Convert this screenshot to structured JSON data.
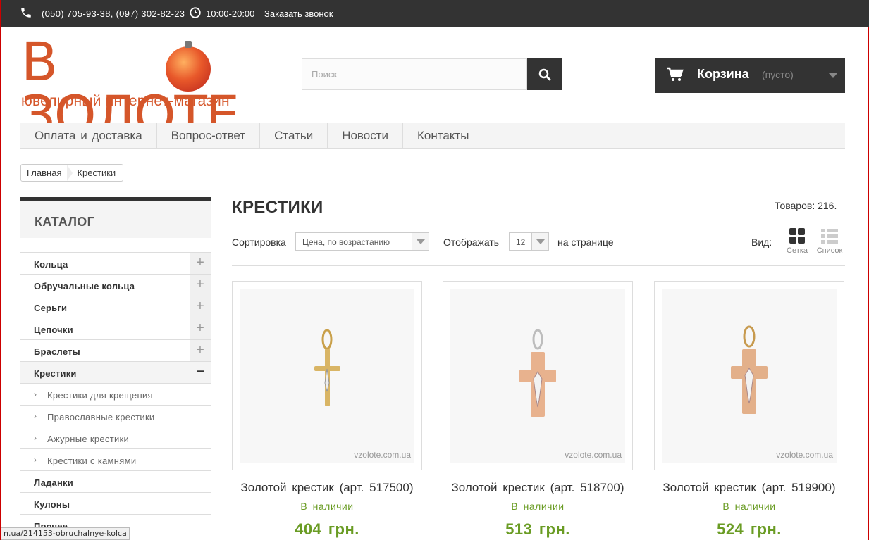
{
  "topbar": {
    "phones": "(050) 705-93-38, (097) 302-82-23",
    "hours": "10:00-20:00",
    "callback": "Заказать звонок"
  },
  "logo": {
    "brand": "В ЗОЛОТЕ",
    "tagline": "ювелирный интернет-магазин"
  },
  "search": {
    "placeholder": "Поиск"
  },
  "cart": {
    "label": "Корзина",
    "status": "(пусто)"
  },
  "nav": [
    "Оплата и доставка",
    "Вопрос-ответ",
    "Статьи",
    "Новости",
    "Контакты"
  ],
  "breadcrumb": {
    "home": "Главная",
    "current": "Крестики"
  },
  "sidebar": {
    "title": "КАТАЛОГ",
    "items": [
      {
        "label": "Кольца",
        "toggle": "+"
      },
      {
        "label": "Обручальные кольца",
        "toggle": "+"
      },
      {
        "label": "Серьги",
        "toggle": "+"
      },
      {
        "label": "Цепочки",
        "toggle": "+"
      },
      {
        "label": "Браслеты",
        "toggle": "+"
      },
      {
        "label": "Крестики",
        "toggle": "−"
      },
      {
        "label": "Ладанки"
      },
      {
        "label": "Кулоны"
      },
      {
        "label": "Прочее"
      }
    ],
    "subitems": [
      "Крестики для крещения",
      "Православные крестики",
      "Ажурные крестики",
      "Крестики с камнями"
    ]
  },
  "page": {
    "title": "КРЕСТИКИ",
    "count": "Товаров: 216.",
    "sort_label": "Сортировка",
    "sort_value": "Цена, по возрастанию",
    "show_label": "Отображать",
    "show_value": "12",
    "per_page": "на странице",
    "view_label": "Вид:",
    "view_grid": "Сетка",
    "view_list": "Список"
  },
  "products": [
    {
      "name": "Золотой крестик (арт. 517500)",
      "stock": "В наличии",
      "price": "404 грн.",
      "watermark": "vzolote.com.ua"
    },
    {
      "name": "Золотой крестик (арт. 518700)",
      "stock": "В наличии",
      "price": "513 грн.",
      "watermark": "vzolote.com.ua"
    },
    {
      "name": "Золотой крестик (арт. 519900)",
      "stock": "В наличии",
      "price": "524 грн.",
      "watermark": "vzolote.com.ua"
    }
  ],
  "statusbar": "n.ua/214153-obruchalnye-kolca",
  "colors": {
    "accent": "#d5562a",
    "dark": "#333333",
    "green": "#6a9c24"
  }
}
